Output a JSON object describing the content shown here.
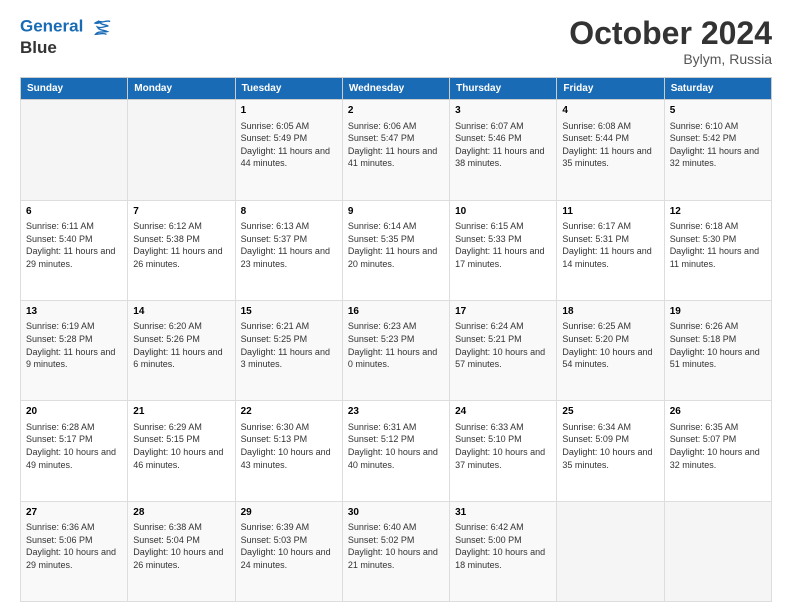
{
  "logo": {
    "line1": "General",
    "line2": "Blue"
  },
  "title": "October 2024",
  "subtitle": "Bylym, Russia",
  "header_days": [
    "Sunday",
    "Monday",
    "Tuesday",
    "Wednesday",
    "Thursday",
    "Friday",
    "Saturday"
  ],
  "weeks": [
    [
      {
        "day": "",
        "info": ""
      },
      {
        "day": "",
        "info": ""
      },
      {
        "day": "1",
        "info": "Sunrise: 6:05 AM\nSunset: 5:49 PM\nDaylight: 11 hours and 44 minutes."
      },
      {
        "day": "2",
        "info": "Sunrise: 6:06 AM\nSunset: 5:47 PM\nDaylight: 11 hours and 41 minutes."
      },
      {
        "day": "3",
        "info": "Sunrise: 6:07 AM\nSunset: 5:46 PM\nDaylight: 11 hours and 38 minutes."
      },
      {
        "day": "4",
        "info": "Sunrise: 6:08 AM\nSunset: 5:44 PM\nDaylight: 11 hours and 35 minutes."
      },
      {
        "day": "5",
        "info": "Sunrise: 6:10 AM\nSunset: 5:42 PM\nDaylight: 11 hours and 32 minutes."
      }
    ],
    [
      {
        "day": "6",
        "info": "Sunrise: 6:11 AM\nSunset: 5:40 PM\nDaylight: 11 hours and 29 minutes."
      },
      {
        "day": "7",
        "info": "Sunrise: 6:12 AM\nSunset: 5:38 PM\nDaylight: 11 hours and 26 minutes."
      },
      {
        "day": "8",
        "info": "Sunrise: 6:13 AM\nSunset: 5:37 PM\nDaylight: 11 hours and 23 minutes."
      },
      {
        "day": "9",
        "info": "Sunrise: 6:14 AM\nSunset: 5:35 PM\nDaylight: 11 hours and 20 minutes."
      },
      {
        "day": "10",
        "info": "Sunrise: 6:15 AM\nSunset: 5:33 PM\nDaylight: 11 hours and 17 minutes."
      },
      {
        "day": "11",
        "info": "Sunrise: 6:17 AM\nSunset: 5:31 PM\nDaylight: 11 hours and 14 minutes."
      },
      {
        "day": "12",
        "info": "Sunrise: 6:18 AM\nSunset: 5:30 PM\nDaylight: 11 hours and 11 minutes."
      }
    ],
    [
      {
        "day": "13",
        "info": "Sunrise: 6:19 AM\nSunset: 5:28 PM\nDaylight: 11 hours and 9 minutes."
      },
      {
        "day": "14",
        "info": "Sunrise: 6:20 AM\nSunset: 5:26 PM\nDaylight: 11 hours and 6 minutes."
      },
      {
        "day": "15",
        "info": "Sunrise: 6:21 AM\nSunset: 5:25 PM\nDaylight: 11 hours and 3 minutes."
      },
      {
        "day": "16",
        "info": "Sunrise: 6:23 AM\nSunset: 5:23 PM\nDaylight: 11 hours and 0 minutes."
      },
      {
        "day": "17",
        "info": "Sunrise: 6:24 AM\nSunset: 5:21 PM\nDaylight: 10 hours and 57 minutes."
      },
      {
        "day": "18",
        "info": "Sunrise: 6:25 AM\nSunset: 5:20 PM\nDaylight: 10 hours and 54 minutes."
      },
      {
        "day": "19",
        "info": "Sunrise: 6:26 AM\nSunset: 5:18 PM\nDaylight: 10 hours and 51 minutes."
      }
    ],
    [
      {
        "day": "20",
        "info": "Sunrise: 6:28 AM\nSunset: 5:17 PM\nDaylight: 10 hours and 49 minutes."
      },
      {
        "day": "21",
        "info": "Sunrise: 6:29 AM\nSunset: 5:15 PM\nDaylight: 10 hours and 46 minutes."
      },
      {
        "day": "22",
        "info": "Sunrise: 6:30 AM\nSunset: 5:13 PM\nDaylight: 10 hours and 43 minutes."
      },
      {
        "day": "23",
        "info": "Sunrise: 6:31 AM\nSunset: 5:12 PM\nDaylight: 10 hours and 40 minutes."
      },
      {
        "day": "24",
        "info": "Sunrise: 6:33 AM\nSunset: 5:10 PM\nDaylight: 10 hours and 37 minutes."
      },
      {
        "day": "25",
        "info": "Sunrise: 6:34 AM\nSunset: 5:09 PM\nDaylight: 10 hours and 35 minutes."
      },
      {
        "day": "26",
        "info": "Sunrise: 6:35 AM\nSunset: 5:07 PM\nDaylight: 10 hours and 32 minutes."
      }
    ],
    [
      {
        "day": "27",
        "info": "Sunrise: 6:36 AM\nSunset: 5:06 PM\nDaylight: 10 hours and 29 minutes."
      },
      {
        "day": "28",
        "info": "Sunrise: 6:38 AM\nSunset: 5:04 PM\nDaylight: 10 hours and 26 minutes."
      },
      {
        "day": "29",
        "info": "Sunrise: 6:39 AM\nSunset: 5:03 PM\nDaylight: 10 hours and 24 minutes."
      },
      {
        "day": "30",
        "info": "Sunrise: 6:40 AM\nSunset: 5:02 PM\nDaylight: 10 hours and 21 minutes."
      },
      {
        "day": "31",
        "info": "Sunrise: 6:42 AM\nSunset: 5:00 PM\nDaylight: 10 hours and 18 minutes."
      },
      {
        "day": "",
        "info": ""
      },
      {
        "day": "",
        "info": ""
      }
    ]
  ]
}
